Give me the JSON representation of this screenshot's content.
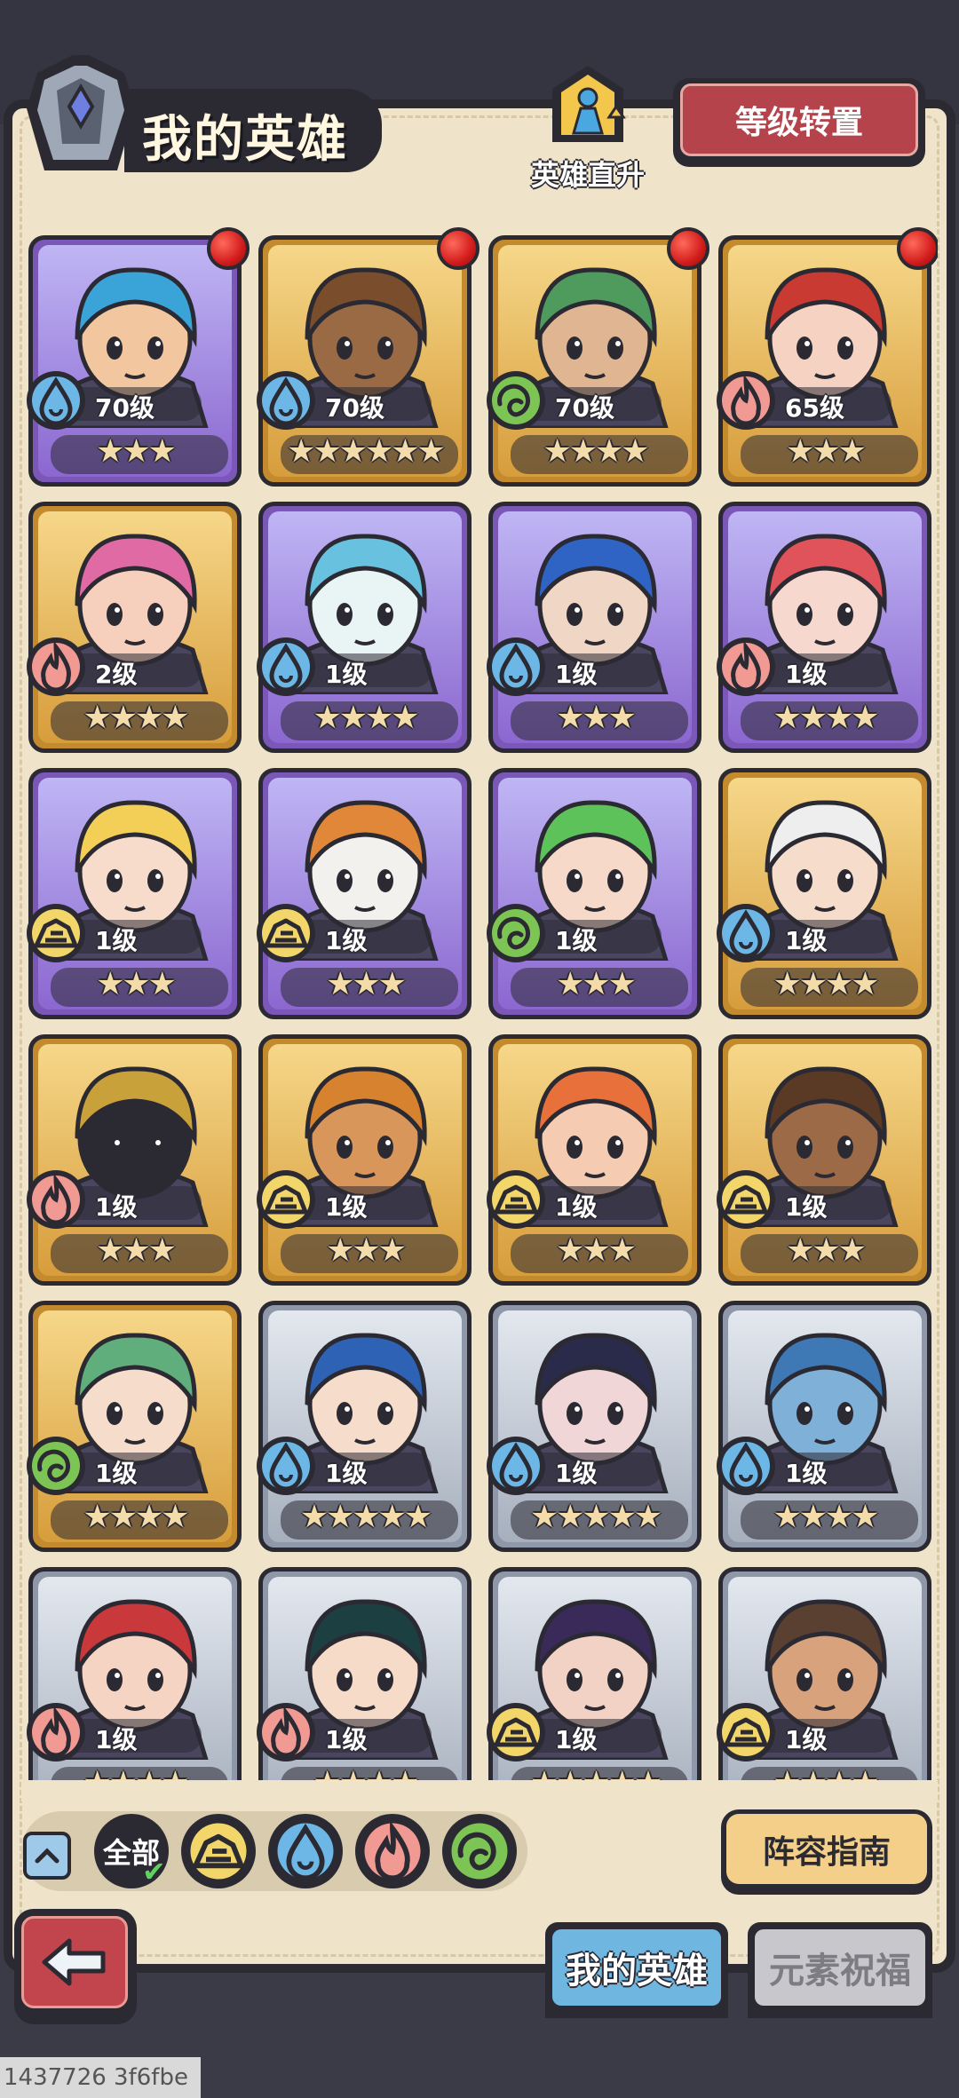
{
  "header": {
    "title": "我的英雄",
    "upgrade_label": "英雄直升",
    "reset_label": "等级转置"
  },
  "heroes": [
    {
      "level": "70级",
      "element": "water",
      "stars": "★★★",
      "rarity": "purple",
      "notify": true,
      "skin": "#f2c7a0",
      "hair": "#3aa3d8"
    },
    {
      "level": "70级",
      "element": "water",
      "stars": "★★★★★★",
      "rarity": "gold",
      "notify": true,
      "skin": "#9a6a45",
      "hair": "#7a4d2c"
    },
    {
      "level": "70级",
      "element": "wind",
      "stars": "★★★★",
      "rarity": "gold",
      "notify": true,
      "skin": "#e0b592",
      "hair": "#4f9b5e"
    },
    {
      "level": "65级",
      "element": "fire",
      "stars": "★★★",
      "rarity": "gold",
      "notify": true,
      "skin": "#f5d2c2",
      "hair": "#c93a32"
    },
    {
      "level": "2级",
      "element": "fire",
      "stars": "★★★★",
      "rarity": "gold",
      "notify": false,
      "skin": "#f6d0bd",
      "hair": "#e06aa4"
    },
    {
      "level": "1级",
      "element": "water",
      "stars": "★★★★",
      "rarity": "purple",
      "notify": false,
      "skin": "#e9f4f5",
      "hair": "#69c1e0"
    },
    {
      "level": "1级",
      "element": "water",
      "stars": "★★★",
      "rarity": "purple",
      "notify": false,
      "skin": "#f0d6c4",
      "hair": "#2f64c4"
    },
    {
      "level": "1级",
      "element": "fire",
      "stars": "★★★★",
      "rarity": "purple",
      "notify": false,
      "skin": "#f6d8ce",
      "hair": "#e0535a"
    },
    {
      "level": "1级",
      "element": "earth",
      "stars": "★★★",
      "rarity": "purple",
      "notify": false,
      "skin": "#f8dccb",
      "hair": "#f3cf57"
    },
    {
      "level": "1级",
      "element": "earth",
      "stars": "★★★",
      "rarity": "purple",
      "notify": false,
      "skin": "#f2f1ee",
      "hair": "#e0873a"
    },
    {
      "level": "1级",
      "element": "wind",
      "stars": "★★★",
      "rarity": "purple",
      "notify": false,
      "skin": "#f6d9c8",
      "hair": "#5ec25a"
    },
    {
      "level": "1级",
      "element": "water",
      "stars": "★★★★",
      "rarity": "gold",
      "notify": false,
      "skin": "#f6dccb",
      "hair": "#eeeeee"
    },
    {
      "level": "1级",
      "element": "fire",
      "stars": "★★★",
      "rarity": "gold",
      "notify": false,
      "skin": "#2b2a33",
      "hair": "#c9a13b"
    },
    {
      "level": "1级",
      "element": "earth",
      "stars": "★★★",
      "rarity": "gold",
      "notify": false,
      "skin": "#d9965a",
      "hair": "#d7822f"
    },
    {
      "level": "1级",
      "element": "earth",
      "stars": "★★★",
      "rarity": "gold",
      "notify": false,
      "skin": "#f5cbb2",
      "hair": "#e8703a"
    },
    {
      "level": "1级",
      "element": "earth",
      "stars": "★★★",
      "rarity": "gold",
      "notify": false,
      "skin": "#9d6a48",
      "hair": "#5a3a25"
    },
    {
      "level": "1级",
      "element": "wind",
      "stars": "★★★★",
      "rarity": "gold",
      "notify": false,
      "skin": "#f6dccb",
      "hair": "#5fae7c"
    },
    {
      "level": "1级",
      "element": "water",
      "stars": "★★★★★",
      "rarity": "silver",
      "notify": false,
      "skin": "#f6dccb",
      "hair": "#2d62b5"
    },
    {
      "level": "1级",
      "element": "water",
      "stars": "★★★★★",
      "rarity": "silver",
      "notify": false,
      "skin": "#f1d6d8",
      "hair": "#2a2a4a"
    },
    {
      "level": "1级",
      "element": "water",
      "stars": "★★★★",
      "rarity": "silver",
      "notify": false,
      "skin": "#7fb0d8",
      "hair": "#3e78b5"
    },
    {
      "level": "1级",
      "element": "fire",
      "stars": "★★★★",
      "rarity": "silver",
      "notify": false,
      "skin": "#f6d4c3",
      "hair": "#c9383b"
    },
    {
      "level": "1级",
      "element": "fire",
      "stars": "★★★★",
      "rarity": "silver",
      "notify": false,
      "skin": "#f5dbc8",
      "hair": "#1c3f42"
    },
    {
      "level": "1级",
      "element": "earth",
      "stars": "★★★★★",
      "rarity": "silver",
      "notify": false,
      "skin": "#f2d2c4",
      "hair": "#3a2a5a"
    },
    {
      "level": "1级",
      "element": "earth",
      "stars": "★★★★",
      "rarity": "silver",
      "notify": false,
      "skin": "#d8a27c",
      "hair": "#5a4030"
    }
  ],
  "element_colors": {
    "water": "#6db7e6",
    "fire": "#f19a93",
    "wind": "#7cc554",
    "earth": "#f3d66a"
  },
  "filters": {
    "all_label": "全部",
    "items": [
      "earth",
      "water",
      "fire",
      "wind"
    ]
  },
  "guide_label": "阵容指南",
  "tabs": {
    "my_heroes": "我的英雄",
    "element_blessing": "元素祝福"
  },
  "footer_id": "1437726 3f6fbe"
}
